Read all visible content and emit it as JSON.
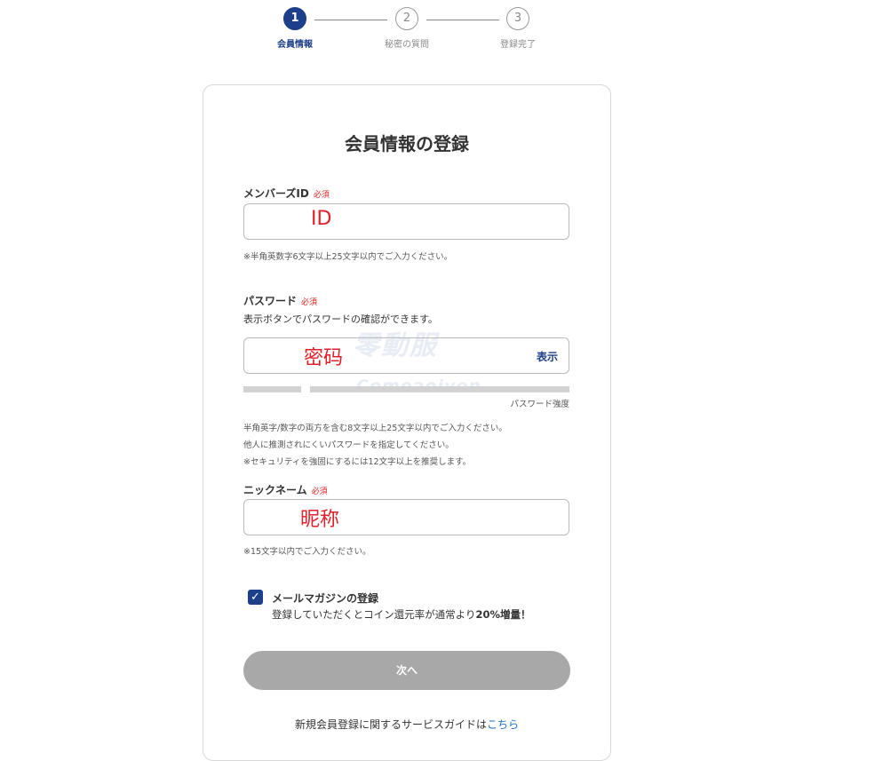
{
  "stepper": {
    "steps": [
      {
        "number": "1",
        "label": "会員情報"
      },
      {
        "number": "2",
        "label": "秘密の質問"
      },
      {
        "number": "3",
        "label": "登録完了"
      }
    ]
  },
  "form": {
    "title": "会員情報の登録",
    "required_label": "必須",
    "member_id": {
      "label": "メンバーズID",
      "value": "ID",
      "hint": "※半角英数字6文字以上25文字以内でご入力ください。"
    },
    "password": {
      "label": "パスワード",
      "description": "表示ボタンでパスワードの確認ができます。",
      "value": "密码",
      "show_button": "表示",
      "strength_label": "パスワード強度",
      "hints": [
        "半角英字/数字の両方を含む8文字以上25文字以内でご入力ください。",
        "他人に推測されにくいパスワードを指定してください。",
        "※セキュリティを強固にするには12文字以上を推奨します。"
      ]
    },
    "nickname": {
      "label": "ニックネーム",
      "value": "昵称",
      "hint": "※15文字以内でご入力ください。"
    },
    "newsletter": {
      "title": "メールマガジンの登録",
      "desc_prefix": "登録していただくとコイン還元率が通常より",
      "desc_bold": "20%増量！",
      "checked": true
    },
    "next_button": "次へ",
    "guide_prefix": "新規会員登録に関するサービスガイドは",
    "guide_link": "こちら"
  },
  "watermark": {
    "text": "零動服",
    "subtext": "Comeaoiven"
  },
  "colors": {
    "accent": "#1d3f8a",
    "required": "#dd2222",
    "input_value": "#e0202a",
    "disabled_button": "#a8a8a8",
    "link": "#1d6fbf"
  }
}
